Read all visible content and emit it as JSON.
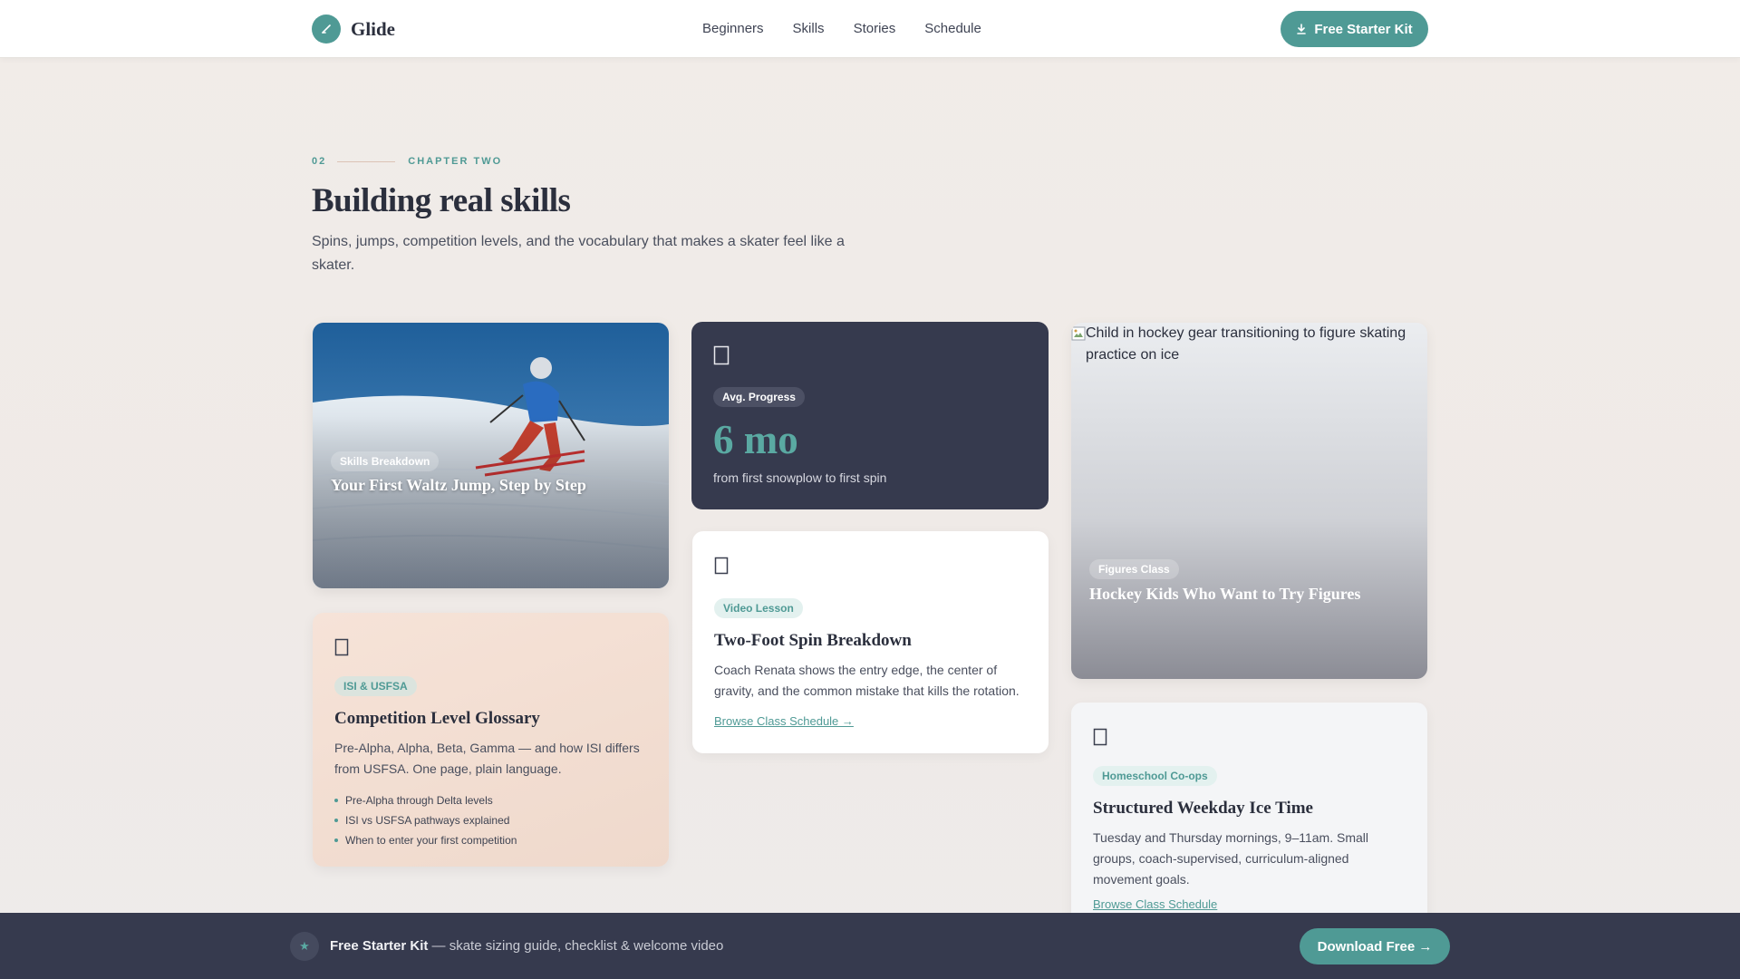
{
  "header": {
    "brand": "Glide",
    "nav": [
      "Beginners",
      "Skills",
      "Stories",
      "Schedule"
    ],
    "cta_label": "Free Starter Kit"
  },
  "section": {
    "number": "02",
    "eyebrow": "CHAPTER TWO",
    "title": "Building real skills",
    "subtitle": "Spins, jumps, competition levels, and the vocabulary that makes a skater feel like a skater."
  },
  "cards": {
    "waltz": {
      "tag": "Skills Breakdown",
      "title": "Your First Waltz Jump, Step by Step"
    },
    "progress": {
      "icon": "clock-icon",
      "tag": "Avg. Progress",
      "value": "6 mo",
      "caption": "from first snowplow to first spin"
    },
    "spin": {
      "icon": "video-icon",
      "tag": "Video Lesson",
      "title": "Two-Foot Spin Breakdown",
      "description": "Coach Renata shows the entry edge, the center of gravity, and the common mistake that kills the rotation.",
      "link": "Browse Class Schedule →"
    },
    "glossary": {
      "icon": "book-icon",
      "tag": "ISI & USFSA",
      "title": "Competition Level Glossary",
      "description": "Pre-Alpha, Alpha, Beta, Gamma — and how ISI differs from USFSA. One page, plain language.",
      "bullets": [
        "Pre-Alpha through Delta levels",
        "ISI vs USFSA pathways explained",
        "When to enter your first competition"
      ]
    },
    "hockey": {
      "image_alt": "Child in hockey gear transitioning to figure skating practice on ice",
      "tag": "Figures Class",
      "title": "Hockey Kids Who Want to Try Figures"
    },
    "weekday": {
      "icon": "calendar-icon",
      "tag": "Homeschool Co-ops",
      "title": "Structured Weekday Ice Time",
      "description": "Tuesday and Thursday mornings, 9–11am. Small groups, coach-supervised, curriculum-aligned movement goals.",
      "link": "Browse Class Schedule"
    }
  },
  "bottom_bar": {
    "title": "Free Starter Kit",
    "text": " — skate sizing guide, checklist & welcome video",
    "cta_label": "Download Free →"
  },
  "colors": {
    "accent": "#4f9a95",
    "dark": "#363a4e",
    "text": "#2b2f3d"
  }
}
